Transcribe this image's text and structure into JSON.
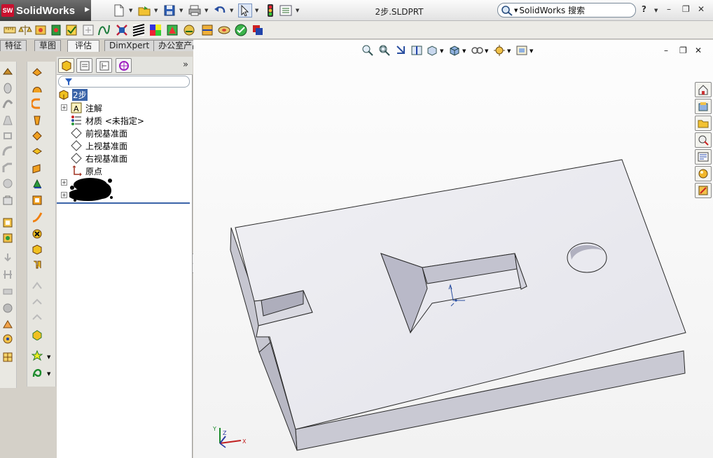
{
  "app": {
    "name": "SolidWorks",
    "logo_mark": "SW",
    "document_title": "2步.SLDPRT",
    "search_placeholder": "SolidWorks 搜索",
    "help_label": "?"
  },
  "command_tabs": [
    {
      "label": "特征",
      "active": false
    },
    {
      "label": "草图",
      "active": false
    },
    {
      "label": "评估",
      "active": true
    },
    {
      "label": "DimXpert",
      "active": false
    },
    {
      "label": "办公室产品",
      "active": false
    }
  ],
  "feature_tree": {
    "root": "2步",
    "items": [
      {
        "label": "注解",
        "icon": "annotation-icon",
        "expandable": true
      },
      {
        "label": "材质 <未指定>",
        "icon": "material-icon",
        "expandable": false
      },
      {
        "label": "前视基准面",
        "icon": "plane-icon",
        "expandable": false
      },
      {
        "label": "上视基准面",
        "icon": "plane-icon",
        "expandable": false
      },
      {
        "label": "右视基准面",
        "icon": "plane-icon",
        "expandable": false
      },
      {
        "label": "原点",
        "icon": "origin-icon",
        "expandable": false
      }
    ],
    "more_label": "»"
  },
  "triad": {
    "x_label": "X",
    "y_label": "Y",
    "z_label": "Z"
  },
  "colors": {
    "title_gradient_top": "#fbfbfb",
    "logo_red": "#c8102e",
    "part_face_top": "#eaeaf0",
    "part_face_side": "#bdbdc8",
    "part_edge": "#2a2a2a",
    "selection_blue": "#3b64a8"
  }
}
